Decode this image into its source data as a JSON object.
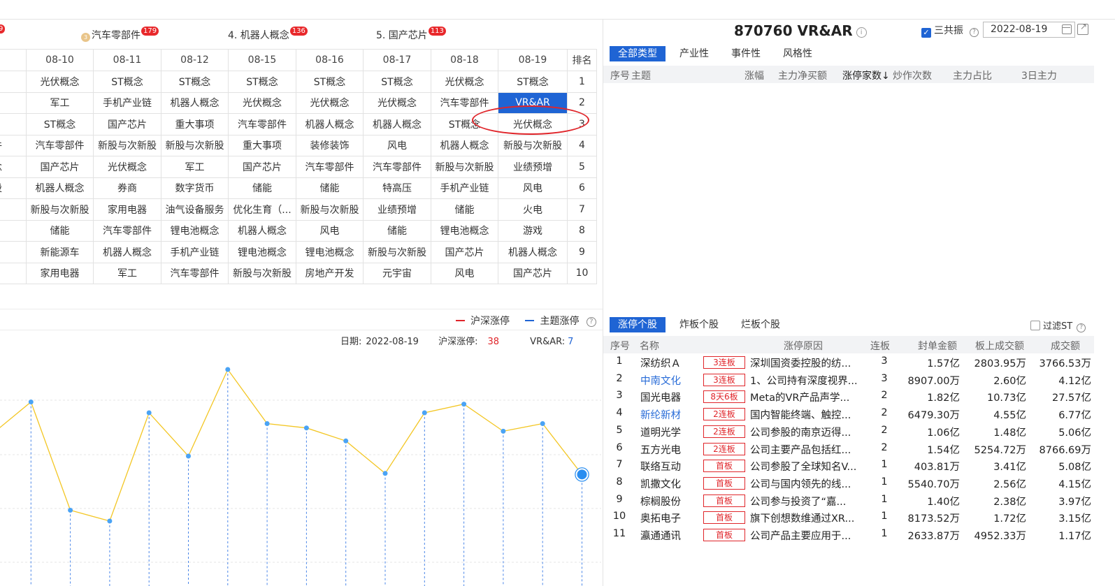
{
  "left": {
    "top_concepts": [
      {
        "label": "汽车零部件",
        "badge": "179",
        "medal": "3"
      },
      {
        "label": "4. 机器人概念",
        "badge": "136"
      },
      {
        "label": "5. 国产芯片",
        "badge": "113"
      }
    ],
    "edge_badge": "9",
    "table": {
      "headers": [
        "9",
        "08-10",
        "08-11",
        "08-12",
        "08-15",
        "08-16",
        "08-17",
        "08-18",
        "08-19",
        "排名"
      ],
      "rows": [
        [
          "念",
          "光伏概念",
          "ST概念",
          "ST概念",
          "ST概念",
          "ST概念",
          "ST概念",
          "光伏概念",
          "ST概念",
          "1"
        ],
        [
          "念",
          "军工",
          "手机产业链",
          "机器人概念",
          "光伏概念",
          "光伏概念",
          "光伏概念",
          "汽车零部件",
          "VR&AR",
          "2"
        ],
        [
          "片",
          "ST概念",
          "国产芯片",
          "重大事项",
          "汽车零部件",
          "机器人概念",
          "机器人概念",
          "ST概念",
          "光伏概念",
          "3"
        ],
        [
          "部件",
          "汽车零部件",
          "新股与次新股",
          "新股与次新股",
          "重大事项",
          "装修装饰",
          "风电",
          "机器人概念",
          "新股与次新股",
          "4"
        ],
        [
          "概念",
          "国产芯片",
          "光伏概念",
          "军工",
          "国产芯片",
          "汽车零部件",
          "汽车零部件",
          "新股与次新股",
          "业绩预增",
          "5"
        ],
        [
          "新股",
          "机器人概念",
          "券商",
          "数字货币",
          "储能",
          "储能",
          "特高压",
          "手机产业链",
          "风电",
          "6"
        ],
        [
          "",
          "新股与次新股",
          "家用电器",
          "油气设备服务",
          "优化生育（...",
          "新股与次新股",
          "业绩预增",
          "储能",
          "火电",
          "7"
        ],
        [
          "",
          "储能",
          "汽车零部件",
          "锂电池概念",
          "机器人概念",
          "风电",
          "储能",
          "锂电池概念",
          "游戏",
          "8"
        ],
        [
          "驶",
          "新能源车",
          "机器人概念",
          "手机产业链",
          "锂电池概念",
          "锂电池概念",
          "新股与次新股",
          "国产芯片",
          "机器人概念",
          "9"
        ],
        [
          "念",
          "家用电器",
          "军工",
          "汽车零部件",
          "新股与次新股",
          "房地产开发",
          "元宇宙",
          "风电",
          "国产芯片",
          "10"
        ]
      ]
    },
    "legend": {
      "series1": "沪深涨停",
      "series2": "主题涨停",
      "help": "?"
    },
    "info": {
      "date_label": "日期:",
      "date": "2022-08-19",
      "hs_label": "沪深涨停:",
      "hs_value": "38",
      "theme_label": "VR&AR:",
      "theme_value": "7"
    },
    "colors": {
      "red": "#e0252a",
      "blue": "#1f64d4",
      "line": "#f3c623"
    }
  },
  "chart_data": {
    "type": "line",
    "title": "",
    "xlabel": "",
    "ylabel": "",
    "series": [
      {
        "name": "主题涨停",
        "values": [
          14,
          17,
          7,
          6,
          16,
          12,
          20,
          15,
          14.6,
          13.4,
          10.4,
          16,
          16.8,
          14.3,
          15,
          10.3
        ]
      }
    ],
    "highlight_index": 15,
    "ylim": [
      0,
      22
    ]
  },
  "right": {
    "title": "870760 VR&AR",
    "info_icon": "i",
    "checkbox_label": "三共振",
    "checkbox_mark": "✓",
    "help": "?",
    "date": "2022-08-19",
    "tabs1": [
      "全部类型",
      "产业性",
      "事件性",
      "风格性"
    ],
    "head1": [
      "序号",
      "主题",
      "涨幅",
      "主力净买额",
      "涨停家数↓",
      "炒作次数",
      "主力占比",
      "3日主力"
    ],
    "tabs2": [
      "涨停个股",
      "炸板个股",
      "烂板个股"
    ],
    "filter_label": "过滤ST",
    "head2": [
      "序号",
      "名称",
      "涨停原因",
      "连板",
      "封单金额",
      "板上成交额",
      "成交额"
    ],
    "stocks": [
      {
        "no": "1",
        "name": "深纺织Ａ",
        "blue": false,
        "tag": "3连板",
        "reason": "深圳国资委控股的纺...",
        "lb": "3",
        "fd": "1.57亿",
        "bs": "2803.95万",
        "cj": "3766.53万"
      },
      {
        "no": "2",
        "name": "中南文化",
        "blue": true,
        "tag": "3连板",
        "reason": "1、公司持有深度视界...",
        "lb": "3",
        "fd": "8907.00万",
        "bs": "2.60亿",
        "cj": "4.12亿"
      },
      {
        "no": "3",
        "name": "国光电器",
        "blue": false,
        "tag": "8天6板",
        "reason": "Meta的VR产品声学...",
        "lb": "2",
        "fd": "1.82亿",
        "bs": "10.73亿",
        "cj": "27.57亿"
      },
      {
        "no": "4",
        "name": "新纶新材",
        "blue": true,
        "tag": "2连板",
        "reason": "国内智能终端、触控...",
        "lb": "2",
        "fd": "6479.30万",
        "bs": "4.55亿",
        "cj": "6.77亿"
      },
      {
        "no": "5",
        "name": "道明光学",
        "blue": false,
        "tag": "2连板",
        "reason": "公司参股的南京迈得...",
        "lb": "2",
        "fd": "1.06亿",
        "bs": "1.48亿",
        "cj": "5.06亿"
      },
      {
        "no": "6",
        "name": "五方光电",
        "blue": false,
        "tag": "2连板",
        "reason": "公司主要产品包括红...",
        "lb": "2",
        "fd": "1.54亿",
        "bs": "5254.72万",
        "cj": "8766.69万"
      },
      {
        "no": "7",
        "name": "联络互动",
        "blue": false,
        "tag": "首板",
        "reason": "公司参股了全球知名V...",
        "lb": "1",
        "fd": "403.81万",
        "bs": "3.41亿",
        "cj": "5.08亿"
      },
      {
        "no": "8",
        "name": "凯撒文化",
        "blue": false,
        "tag": "首板",
        "reason": "公司与国内领先的线...",
        "lb": "1",
        "fd": "5540.70万",
        "bs": "2.56亿",
        "cj": "4.15亿"
      },
      {
        "no": "9",
        "name": "棕榈股份",
        "blue": false,
        "tag": "首板",
        "reason": "公司参与投资了“嘉...",
        "lb": "1",
        "fd": "1.40亿",
        "bs": "2.38亿",
        "cj": "3.97亿"
      },
      {
        "no": "10",
        "name": "奥拓电子",
        "blue": false,
        "tag": "首板",
        "reason": "旗下创想数维通过XR...",
        "lb": "1",
        "fd": "8173.52万",
        "bs": "1.72亿",
        "cj": "3.15亿"
      },
      {
        "no": "11",
        "name": "瀛通通讯",
        "blue": false,
        "tag": "首板",
        "reason": "公司产品主要应用于...",
        "lb": "1",
        "fd": "2633.87万",
        "bs": "4952.33万",
        "cj": "1.17亿"
      }
    ]
  }
}
